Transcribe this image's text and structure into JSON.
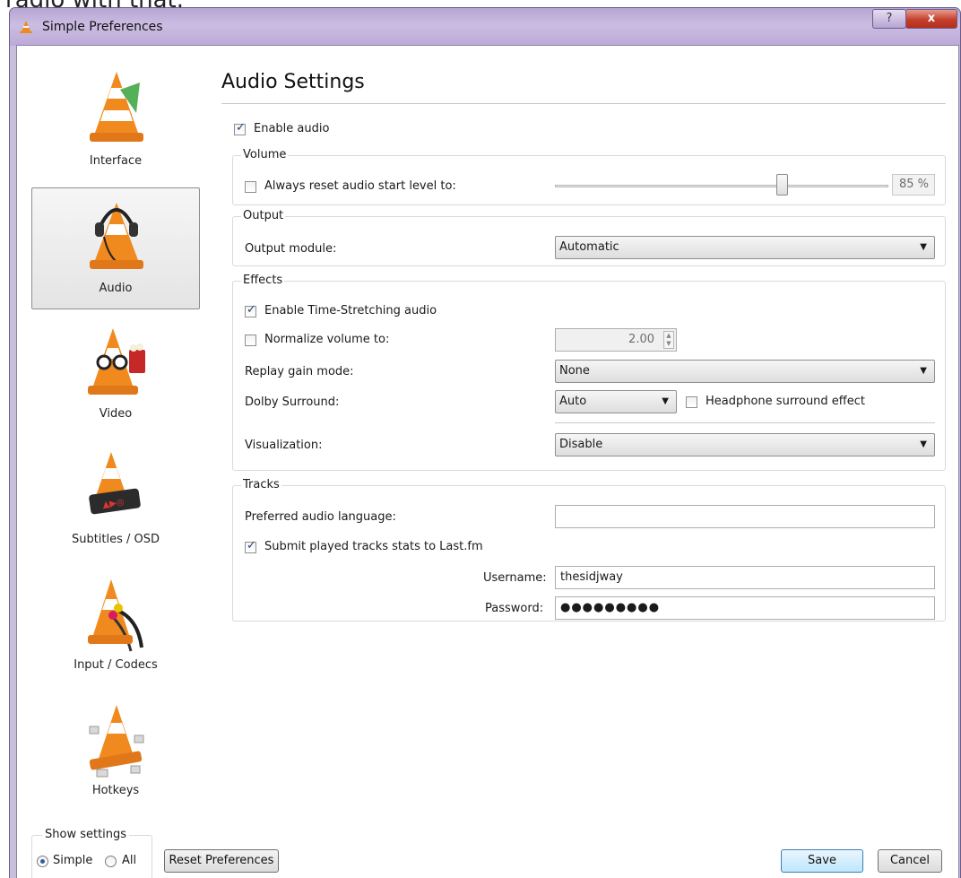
{
  "cut_text": "radio with that.",
  "window": {
    "title": "Simple Preferences",
    "help_glyph": "?",
    "close_glyph": "x"
  },
  "sidebar": {
    "items": [
      {
        "label": "Interface",
        "icon": "vlc-cone-interface-icon",
        "active": false
      },
      {
        "label": "Audio",
        "icon": "vlc-cone-headphones-icon",
        "active": true
      },
      {
        "label": "Video",
        "icon": "vlc-cone-glasses-icon",
        "active": false
      },
      {
        "label": "Subtitles / OSD",
        "icon": "vlc-cone-display-icon",
        "active": false
      },
      {
        "label": "Input / Codecs",
        "icon": "vlc-cone-cables-icon",
        "active": false
      },
      {
        "label": "Hotkeys",
        "icon": "vlc-cone-keys-icon",
        "active": false
      }
    ],
    "show_settings": {
      "legend": "Show settings",
      "simple": "Simple",
      "all": "All",
      "selected": "Simple"
    }
  },
  "main": {
    "heading": "Audio Settings",
    "enable_audio": {
      "label": "Enable audio",
      "checked": true
    },
    "volume": {
      "title": "Volume",
      "reset_label": "Always reset audio start level to:",
      "reset_checked": false,
      "level_percent": 85,
      "level_text": "85 %"
    },
    "output": {
      "title": "Output",
      "module_label": "Output module:",
      "module_value": "Automatic"
    },
    "effects": {
      "title": "Effects",
      "time_stretch": {
        "label": "Enable Time-Stretching audio",
        "checked": true
      },
      "normalize": {
        "label": "Normalize volume to:",
        "checked": false,
        "value": "2.00"
      },
      "replay_gain": {
        "label": "Replay gain mode:",
        "value": "None"
      },
      "dolby": {
        "label": "Dolby Surround:",
        "value": "Auto"
      },
      "headphone": {
        "label": "Headphone surround effect",
        "checked": false
      },
      "visualization": {
        "label": "Visualization:",
        "value": "Disable"
      }
    },
    "tracks": {
      "title": "Tracks",
      "language_label": "Preferred audio language:",
      "language_value": "",
      "lastfm": {
        "label": "Submit played tracks stats to Last.fm",
        "checked": true
      },
      "username_label": "Username:",
      "username_value": "thesidjway",
      "password_label": "Password:",
      "password_value": "●●●●●●●●●"
    }
  },
  "footer": {
    "reset": "Reset Preferences",
    "save": "Save",
    "cancel": "Cancel"
  },
  "colors": {
    "titlebar": "#c3b3dc",
    "close": "#c3402d",
    "cone_orange": "#f08a1e"
  }
}
